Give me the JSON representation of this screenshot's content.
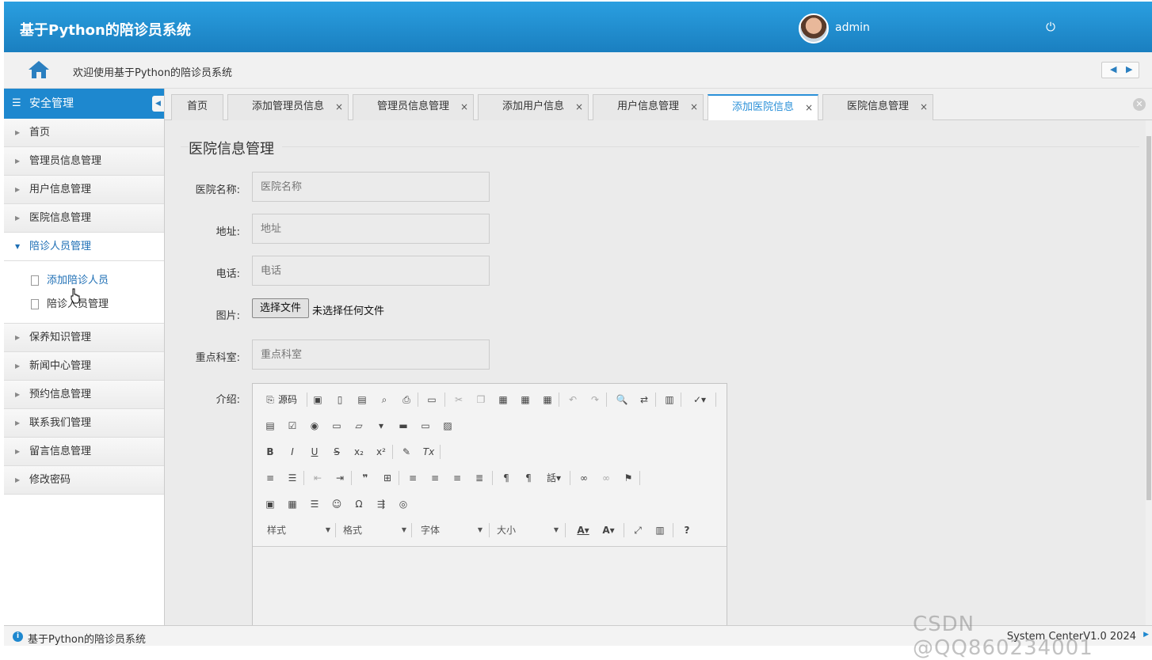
{
  "header": {
    "title": "基于Python的陪诊员系统",
    "user": "admin",
    "avatar_icon": "user-avatar",
    "power_icon": "power-icon"
  },
  "breadcrumb": {
    "welcome": "欢迎使用基于Python的陪诊员系统",
    "home_icon": "home-icon"
  },
  "sidebar": {
    "header": "安全管理",
    "items": [
      {
        "label": "首页"
      },
      {
        "label": "管理员信息管理"
      },
      {
        "label": "用户信息管理"
      },
      {
        "label": "医院信息管理"
      },
      {
        "label": "陪诊人员管理",
        "expanded": true,
        "children": [
          {
            "label": "添加陪诊人员",
            "active": true
          },
          {
            "label": "陪诊人员管理"
          }
        ]
      },
      {
        "label": "保养知识管理"
      },
      {
        "label": "新闻中心管理"
      },
      {
        "label": "预约信息管理"
      },
      {
        "label": "联系我们管理"
      },
      {
        "label": "留言信息管理"
      },
      {
        "label": "修改密码"
      }
    ]
  },
  "tabs": [
    {
      "label": "首页",
      "closable": false
    },
    {
      "label": "添加管理员信息",
      "closable": true
    },
    {
      "label": "管理员信息管理",
      "closable": true
    },
    {
      "label": "添加用户信息",
      "closable": true
    },
    {
      "label": "用户信息管理",
      "closable": true
    },
    {
      "label": "添加医院信息",
      "closable": true,
      "active": true
    },
    {
      "label": "医院信息管理",
      "closable": true
    }
  ],
  "tab_close": "×",
  "form": {
    "legend": "医院信息管理",
    "fields": {
      "name": {
        "label": "医院名称:",
        "placeholder": "医院名称"
      },
      "address": {
        "label": "地址:",
        "placeholder": "地址"
      },
      "phone": {
        "label": "电话:",
        "placeholder": "电话"
      },
      "image": {
        "label": "图片:",
        "button": "选择文件",
        "status": "未选择任何文件"
      },
      "dept": {
        "label": "重点科室:",
        "placeholder": "重点科室"
      },
      "intro": {
        "label": "介绍:"
      }
    }
  },
  "editor": {
    "source_label": "源码",
    "combos": {
      "style": "样式",
      "format": "格式",
      "font": "字体",
      "size": "大小"
    }
  },
  "statusbar": {
    "left": "基于Python的陪诊员系统",
    "right": "System CenterV1.0 2024"
  },
  "watermark": "CSDN @QQ860234001",
  "colors": {
    "accent": "#1e88cf",
    "header": "#1a7fc0",
    "active_text": "#1e6fb5"
  }
}
